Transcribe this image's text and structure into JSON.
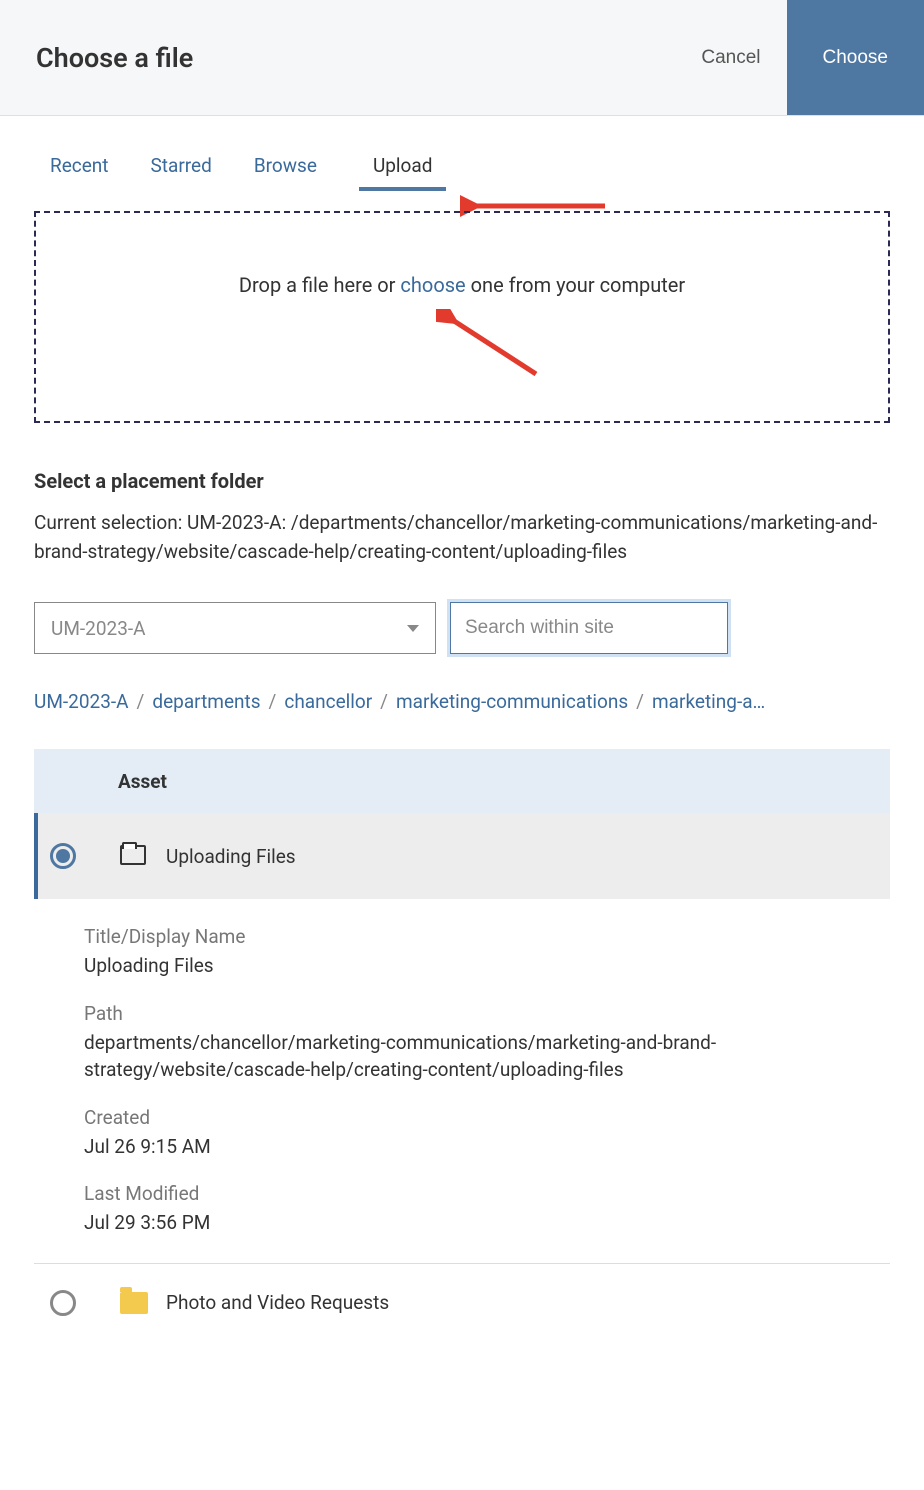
{
  "header": {
    "title": "Choose a file",
    "cancel": "Cancel",
    "choose": "Choose"
  },
  "tabs": {
    "recent": "Recent",
    "starred": "Starred",
    "browse": "Browse",
    "upload": "Upload"
  },
  "dropzone": {
    "prefix": "Drop a file here or ",
    "link": "choose",
    "suffix": " one from your computer"
  },
  "placement": {
    "heading": "Select a placement folder",
    "current_label": "Current selection: ",
    "current_value": "UM-2023-A: /departments/chancellor/marketing-communications/marketing-and-brand-strategy/website/cascade-help/creating-content/uploading-files"
  },
  "controls": {
    "site_value": "UM-2023-A",
    "search_placeholder": "Search within site"
  },
  "breadcrumb": {
    "items": [
      "UM-2023-A",
      "departments",
      "chancellor",
      "marketing-communications",
      "marketing-a…"
    ]
  },
  "table": {
    "header": "Asset",
    "rows": [
      {
        "name": "Uploading Files",
        "selected": true,
        "icon": "outline"
      },
      {
        "name": "Photo and Video Requests",
        "selected": false,
        "icon": "filled"
      }
    ]
  },
  "details": {
    "title_label": "Title/Display Name",
    "title_value": "Uploading Files",
    "path_label": "Path",
    "path_value": "departments/chancellor/marketing-communications/marketing-and-brand-strategy/website/cascade-help/creating-content/uploading-files",
    "created_label": "Created",
    "created_value": "Jul 26 9:15 AM",
    "modified_label": "Last Modified",
    "modified_value": "Jul 29 3:56 PM"
  }
}
